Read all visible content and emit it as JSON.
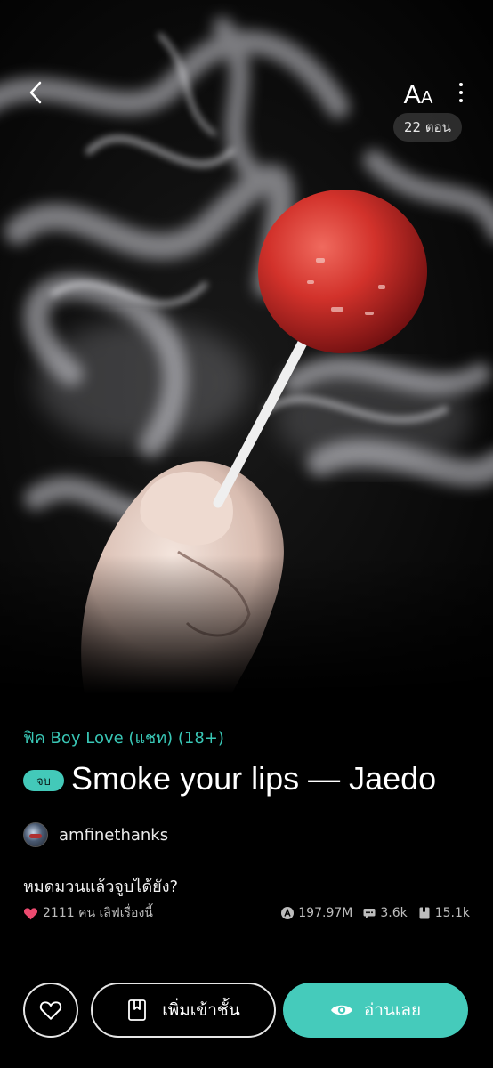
{
  "header": {
    "font_size_label_big": "A",
    "font_size_label_small": "A",
    "episodes": "22 ตอน"
  },
  "story": {
    "genre": "ฟิค Boy Love (แชท) (18+)",
    "status_badge": "จบ",
    "title": "Smoke your lips — Jaedo",
    "author": "amfinethanks",
    "tagline": "หมดมวนแล้วจูบได้ยัง?",
    "likes_text": "2111 คน เลิฟเรื่องนี้",
    "views": "197.97M",
    "comments": "3.6k",
    "library_adds": "15.1k"
  },
  "actions": {
    "add_library_label": "เพิ่มเข้าชั้น",
    "read_label": "อ่านเลย"
  },
  "icons": {
    "back": "chevron-left-icon",
    "more": "more-vertical-icon",
    "heart": "heart-icon",
    "views": "views-icon",
    "comments": "comment-icon",
    "library": "bookmark-book-icon",
    "eye": "eye-icon"
  },
  "colors": {
    "accent": "#45cbbb",
    "genre_text": "#39c7b6",
    "heart": "#ec4a6f",
    "background": "#000000"
  }
}
